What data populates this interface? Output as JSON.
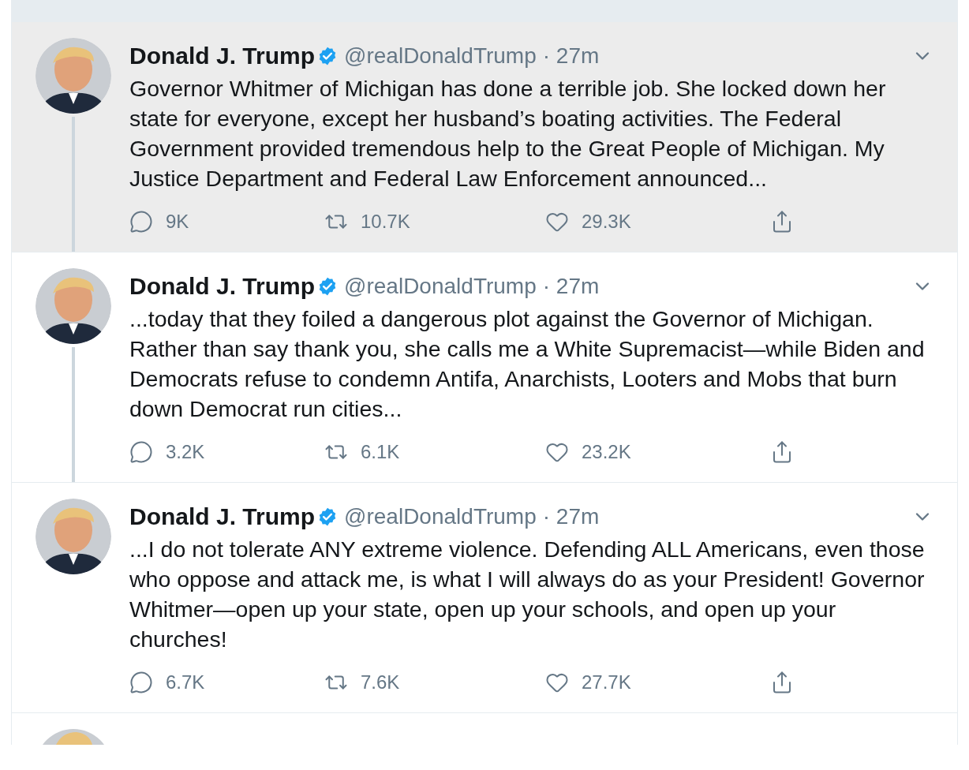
{
  "tweets": [
    {
      "name": "Donald J. Trump",
      "verified": true,
      "handle": "@realDonaldTrump",
      "time": "· 27m",
      "highlighted": true,
      "thread_below": true,
      "text": "Governor Whitmer of Michigan has done a terrible job. She locked down her state for everyone, except her husband’s boating activities. The Federal Government provided tremendous help to the Great People of Michigan. My Justice Department and Federal Law Enforcement announced...",
      "replies": "9K",
      "retweets": "10.7K",
      "likes": "29.3K"
    },
    {
      "name": "Donald J. Trump",
      "verified": true,
      "handle": "@realDonaldTrump",
      "time": "· 27m",
      "highlighted": false,
      "thread_below": true,
      "text": "...today that they foiled a dangerous plot against the Governor of Michigan. Rather than say thank you, she calls me a White Supremacist—while Biden and Democrats refuse to condemn Antifa, Anarchists, Looters and Mobs that burn down Democrat run cities...",
      "replies": "3.2K",
      "retweets": "6.1K",
      "likes": "23.2K"
    },
    {
      "name": "Donald J. Trump",
      "verified": true,
      "handle": "@realDonaldTrump",
      "time": "· 27m",
      "highlighted": false,
      "thread_below": false,
      "text": "...I do not tolerate ANY extreme violence. Defending ALL Americans, even those who oppose and attack me, is what I will always do as your President! Governor Whitmer—open up your state, open up your schools, and open up your churches!",
      "replies": "6.7K",
      "retweets": "7.6K",
      "likes": "27.7K"
    }
  ]
}
